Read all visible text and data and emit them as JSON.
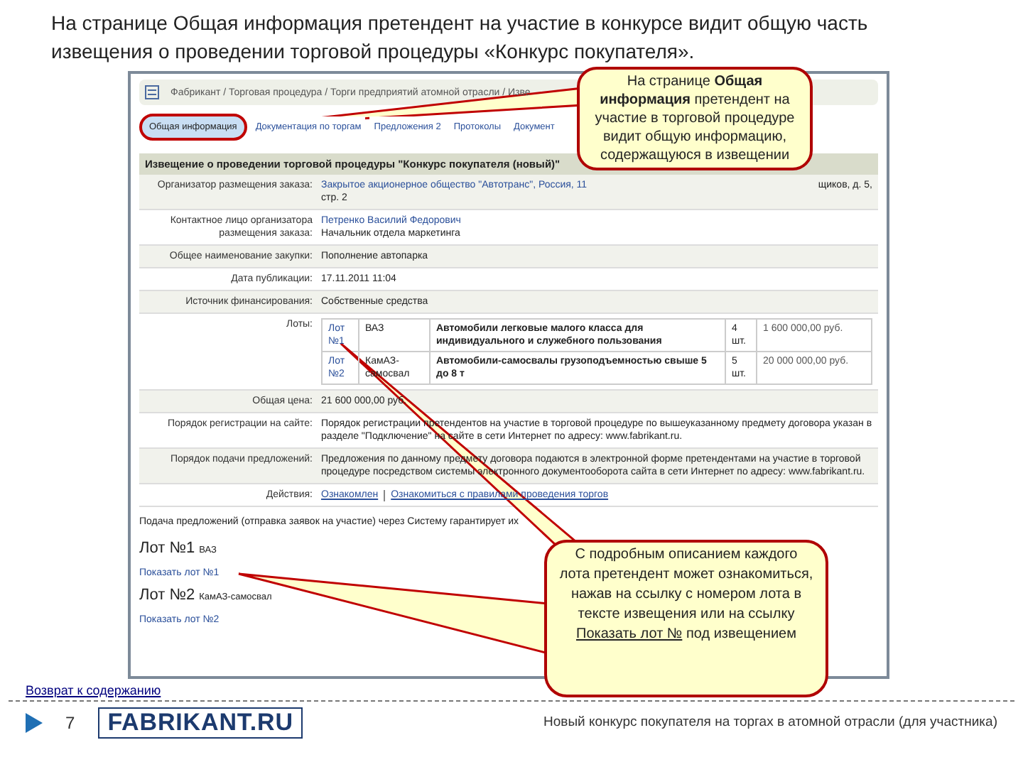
{
  "slide_title": "На странице Общая информация претендент на участие в конкурсе видит общую часть извещения о проведении торговой процедуры «Конкурс покупателя».",
  "screenshot": {
    "breadcrumb": "Фабрикант / Торговая процедура / Торги предприятий атомной отрасли / Изве",
    "tabs": [
      {
        "label": "Общая информация",
        "selected": true
      },
      {
        "label": "Документация по торгам",
        "selected": false
      },
      {
        "label": "Предложения 2",
        "selected": false
      },
      {
        "label": "Протоколы",
        "selected": false
      },
      {
        "label": "Документ",
        "selected": false
      }
    ],
    "notice_title": "Извещение о проведении торговой процедуры \"Конкурс покупателя (новый)\"",
    "fields": [
      {
        "kind": "text",
        "label": "Организатор размещения заказа:",
        "lines": [
          {
            "text": "Закрытое акционерное общество \"Автотранс\", Россия, 11",
            "link": true
          },
          {
            "text": "стр. 2",
            "link": false
          }
        ],
        "tail": "щиков, д. 5,"
      },
      {
        "kind": "text",
        "label": "Контактное лицо организатора размещения заказа:",
        "lines": [
          {
            "text": "Петренко Василий Федорович",
            "link": true
          },
          {
            "text": "Начальник отдела маркетинга",
            "link": false
          }
        ]
      },
      {
        "kind": "text",
        "label": "Общее наименование закупки:",
        "lines": [
          {
            "text": "Пополнение автопарка",
            "link": false
          }
        ]
      },
      {
        "kind": "text",
        "label": "Дата публикации:",
        "lines": [
          {
            "text": "17.11.2011 11:04",
            "link": false
          }
        ]
      },
      {
        "kind": "text",
        "label": "Источник финансирования:",
        "lines": [
          {
            "text": "Собственные средства",
            "link": false
          }
        ]
      },
      {
        "kind": "lots",
        "label": "Лоты:",
        "lots": [
          {
            "number": "Лот №1",
            "name": "ВАЗ",
            "description": "Автомобили легковые малого класса для индивидуального и служебного пользования",
            "quantity": "4 шт.",
            "price": "1 600 000,00 руб."
          },
          {
            "number": "Лот №2",
            "name": "КамАЗ-самосвал",
            "description": "Автомобили-самосвалы грузоподъемностью свыше 5 до 8 т",
            "quantity": "5 шт.",
            "price": "20 000 000,00 руб."
          }
        ]
      },
      {
        "kind": "text",
        "label": "Общая цена:",
        "lines": [
          {
            "text": "21 600 000,00 руб.",
            "link": false
          }
        ]
      },
      {
        "kind": "text",
        "label": "Порядок регистрации на сайте:",
        "lines": [
          {
            "text": "Порядок регистрации претендентов на участие в торговой процедуре по вышеуказанному предмету договора указан в разделе \"Подключение\" на сайте в сети Интернет по адресу: www.fabrikant.ru.",
            "link": false
          }
        ]
      },
      {
        "kind": "text",
        "label": "Порядок подачи предложений:",
        "lines": [
          {
            "text": "Предложения по данному предмету договора подаются в электронной форме претендентами на участие в торговой процедуре посредством системы электронного документооборота сайта в сети Интернет по адресу: www.fabrikant.ru.",
            "link": false
          }
        ]
      },
      {
        "kind": "actions",
        "label": "Действия:",
        "actions": [
          "Ознакомлен",
          "Ознакомиться с правилами проведения торгов"
        ]
      }
    ],
    "note": "Подача предложений (отправка заявок на участие) через Систему гарантирует их",
    "lot_list": [
      {
        "title": "Лот №1",
        "name": "ВАЗ",
        "link": "Показать лот №1"
      },
      {
        "title": "Лот №2",
        "name": "КамАЗ-самосвал",
        "link": "Показать лот №2"
      }
    ]
  },
  "callouts": [
    {
      "text": "На странице **Общая информация** претендент на участие в торговой процедуре видит общую информацию, содержащуюся в извещении"
    },
    {
      "text": "С подробным описанием каждого лота претендент может ознакомиться, нажав на ссылку с номером лота в тексте извещения или на ссылку",
      "link": "Показать лот №",
      "after": "под извещением"
    }
  ],
  "back_link": "Возврат к содержанию",
  "footer": {
    "page": "7",
    "logo": "FABRIKANT.RU",
    "caption": "Новый конкурс покупателя на торгах в атомной отрасли (для участника)"
  }
}
